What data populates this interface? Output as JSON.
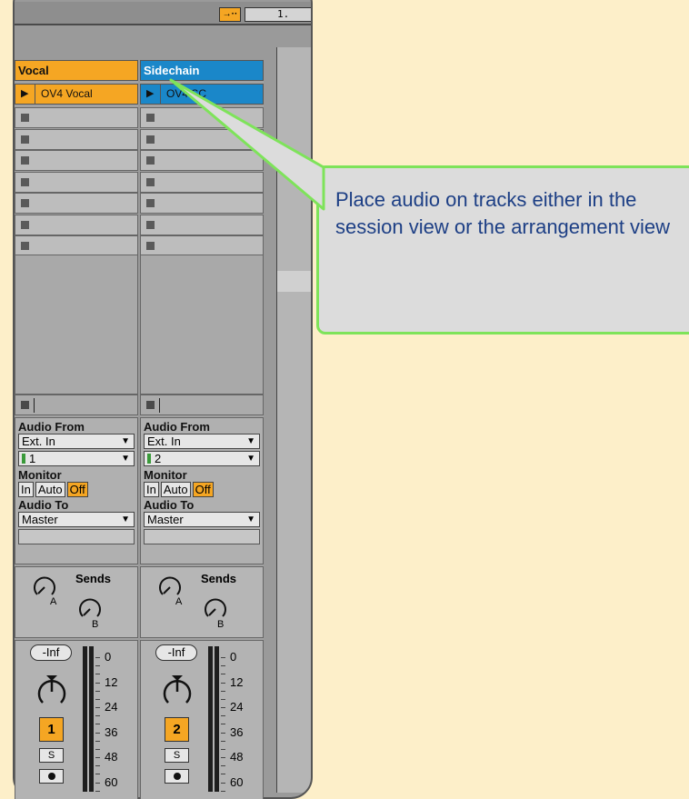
{
  "toolbar": {
    "follow_icon": "follow-arrow-icon",
    "follow_glyph": "→··",
    "position": "1."
  },
  "tracks": [
    {
      "name": "Vocal",
      "color": "#f5a623",
      "clip": "OV4 Vocal",
      "audio_from_label": "Audio From",
      "audio_from": "Ext. In",
      "input_channel": "1",
      "monitor_label": "Monitor",
      "monitor": {
        "in": "In",
        "auto": "Auto",
        "off": "Off"
      },
      "audio_to_label": "Audio To",
      "audio_to": "Master",
      "sends_label": "Sends",
      "send_a": "A",
      "send_b": "B",
      "volume": "-Inf",
      "number": "1",
      "solo": "S"
    },
    {
      "name": "Sidechain",
      "color": "#1a87c9",
      "clip": "OV4 SC",
      "audio_from_label": "Audio From",
      "audio_from": "Ext. In",
      "input_channel": "2",
      "monitor_label": "Monitor",
      "monitor": {
        "in": "In",
        "auto": "Auto",
        "off": "Off"
      },
      "audio_to_label": "Audio To",
      "audio_to": "Master",
      "sends_label": "Sends",
      "send_a": "A",
      "send_b": "B",
      "volume": "-Inf",
      "number": "2",
      "solo": "S"
    }
  ],
  "meter_scale": [
    "0",
    "12",
    "24",
    "36",
    "48",
    "60"
  ],
  "callout": {
    "text": "Place audio on tracks either in the session view or the arrangement view",
    "border_color": "#7ee35a"
  }
}
